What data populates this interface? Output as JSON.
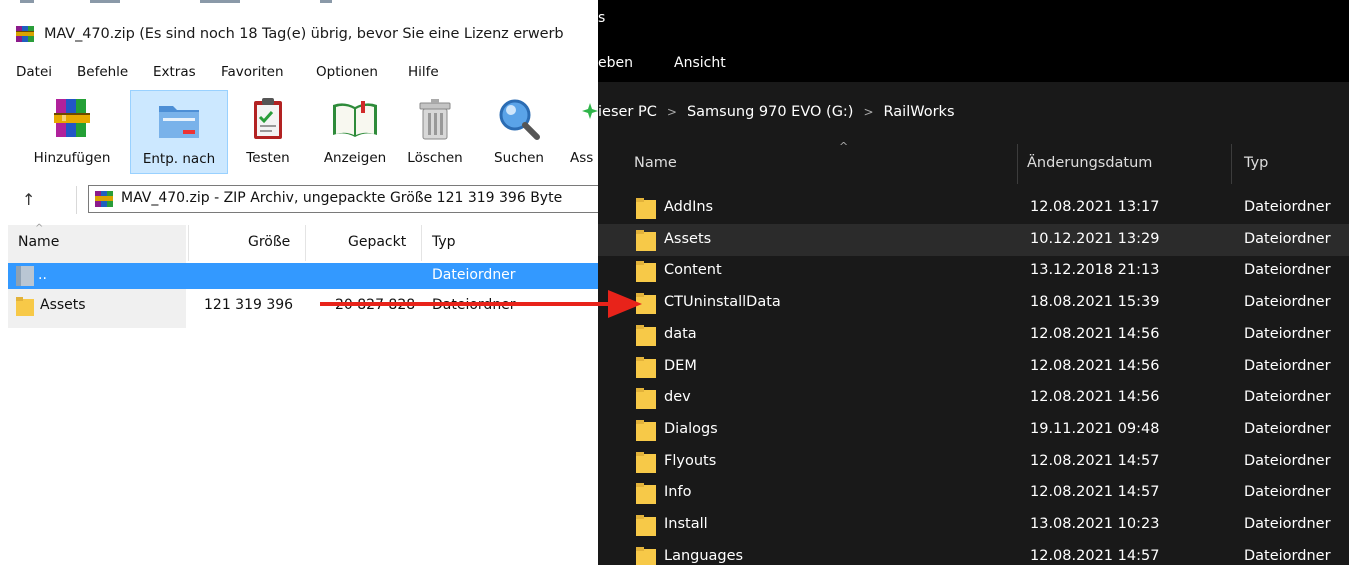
{
  "winrar": {
    "title": "MAV_470.zip (Es sind noch 18 Tag(e) übrig, bevor Sie eine Lizenz erwerb",
    "menu": [
      "Datei",
      "Befehle",
      "Extras",
      "Favoriten",
      "Optionen",
      "Hilfe"
    ],
    "toolbar": [
      {
        "label": "Hinzufügen",
        "icon": "books-add-icon"
      },
      {
        "label": "Entp. nach",
        "icon": "folder-extract-icon"
      },
      {
        "label": "Testen",
        "icon": "clipboard-check-icon"
      },
      {
        "label": "Anzeigen",
        "icon": "open-book-icon"
      },
      {
        "label": "Löschen",
        "icon": "trash-can-icon"
      },
      {
        "label": "Suchen",
        "icon": "magnifier-icon"
      },
      {
        "label": "Ass",
        "icon": "wizard-icon"
      }
    ],
    "address": "MAV_470.zip - ZIP Archiv, ungepackte Größe 121 319 396 Byte",
    "columns": {
      "name": "Name",
      "size": "Größe",
      "packed": "Gepackt",
      "type": "Typ"
    },
    "rows": [
      {
        "name": "..",
        "size": "",
        "packed": "",
        "type": "Dateiordner",
        "selected": true
      },
      {
        "name": "Assets",
        "size": "121 319 396",
        "packed": "20 827 828",
        "type": "Dateiordner",
        "selected": false
      }
    ],
    "colors": {
      "selection": "#3399ff",
      "toolbar_active": "#cce8ff"
    }
  },
  "explorer": {
    "title_fragment": "s",
    "ribbon_tabs": [
      "eben",
      "Ansicht"
    ],
    "breadcrumb": [
      "ieser PC",
      "Samsung 970 EVO (G:)",
      "RailWorks"
    ],
    "columns": {
      "name": "Name",
      "date": "Änderungsdatum",
      "type": "Typ"
    },
    "rows": [
      {
        "name": "AddIns",
        "date": "12.08.2021 13:17",
        "type": "Dateiordner"
      },
      {
        "name": "Assets",
        "date": "10.12.2021 13:29",
        "type": "Dateiordner",
        "hover": true
      },
      {
        "name": "Content",
        "date": "13.12.2018 21:13",
        "type": "Dateiordner"
      },
      {
        "name": "CTUninstallData",
        "date": "18.08.2021 15:39",
        "type": "Dateiordner"
      },
      {
        "name": "data",
        "date": "12.08.2021 14:56",
        "type": "Dateiordner"
      },
      {
        "name": "DEM",
        "date": "12.08.2021 14:56",
        "type": "Dateiordner"
      },
      {
        "name": "dev",
        "date": "12.08.2021 14:56",
        "type": "Dateiordner"
      },
      {
        "name": "Dialogs",
        "date": "19.11.2021 09:48",
        "type": "Dateiordner"
      },
      {
        "name": "Flyouts",
        "date": "12.08.2021 14:57",
        "type": "Dateiordner"
      },
      {
        "name": "Info",
        "date": "12.08.2021 14:57",
        "type": "Dateiordner"
      },
      {
        "name": "Install",
        "date": "13.08.2021 10:23",
        "type": "Dateiordner"
      },
      {
        "name": "Languages",
        "date": "12.08.2021 14:57",
        "type": "Dateiordner"
      }
    ],
    "colors": {
      "background": "#191919",
      "hover_row": "#2b2b2b",
      "folder": "#f7c948"
    }
  },
  "annotation": {
    "color": "#e8231a",
    "icon": "red-arrow"
  }
}
